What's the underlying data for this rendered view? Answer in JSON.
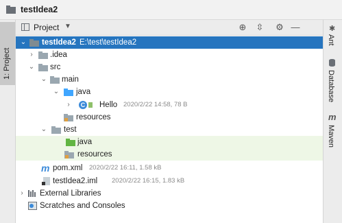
{
  "window": {
    "title": "testIdea2"
  },
  "left_strip": {
    "project_tab_label": "1: Project"
  },
  "right_strip": {
    "tabs": [
      {
        "label": "Ant",
        "icon": "ant-icon"
      },
      {
        "label": "Database",
        "icon": "database-icon"
      },
      {
        "label": "Maven",
        "icon": "maven-icon"
      }
    ]
  },
  "panel": {
    "title": "Project",
    "dropdown_glyph": "▼",
    "buttons": [
      {
        "name": "locate-icon",
        "glyph": "⊕"
      },
      {
        "name": "collapse-all-icon",
        "glyph": "⇳"
      },
      {
        "name": "settings-icon",
        "glyph": "⚙"
      },
      {
        "name": "hide-icon",
        "glyph": "—"
      }
    ]
  },
  "tree": {
    "root": {
      "name": "testIdea2",
      "path": "E:\\test\\testIdea2"
    },
    "idea": {
      "name": ".idea"
    },
    "src": {
      "name": "src"
    },
    "main": {
      "name": "main"
    },
    "java_main": {
      "name": "java"
    },
    "hello": {
      "name": "Hello",
      "meta": "2020/2/22 14:58, 78 B"
    },
    "resources_main": {
      "name": "resources"
    },
    "test": {
      "name": "test"
    },
    "java_test": {
      "name": "java"
    },
    "resources_test": {
      "name": "resources"
    },
    "pom": {
      "name": "pom.xml",
      "meta": "2020/2/22 16:11, 1.58 kB"
    },
    "iml": {
      "name": "testIdea2.iml",
      "meta": "2020/2/22 16:15, 1.83 kB"
    },
    "external_libraries": {
      "name": "External Libraries"
    },
    "scratches": {
      "name": "Scratches and Consoles"
    }
  },
  "glyphs": {
    "expanded": "⌄",
    "collapsed": "›",
    "class_letter": "C",
    "maven_letter": "m"
  },
  "colors": {
    "selection": "#2675bf",
    "test_background": "#eef7e6",
    "source_folder": "#40a6ff",
    "test_folder": "#62b543",
    "plain_folder": "#9aa7b0"
  }
}
